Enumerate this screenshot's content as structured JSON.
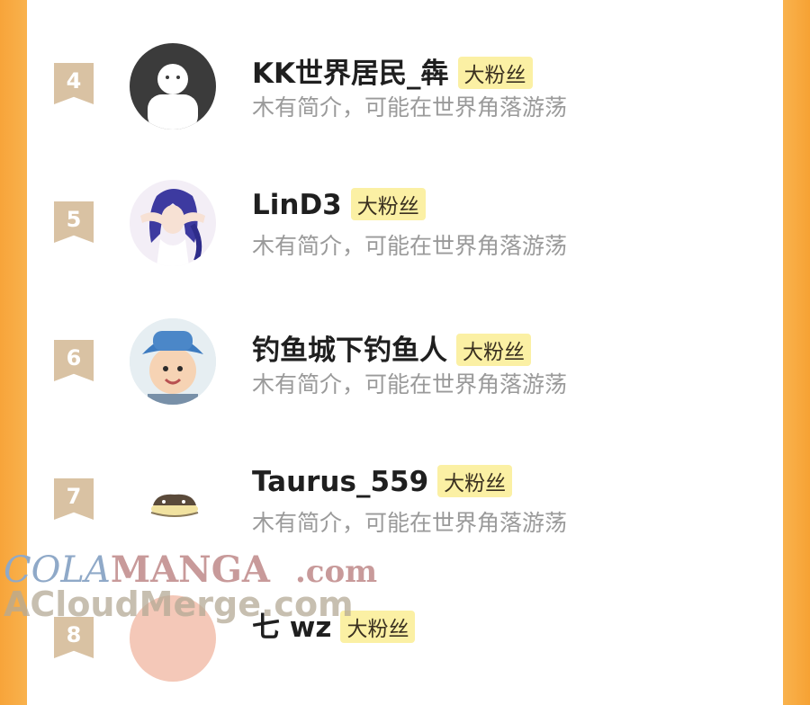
{
  "fans": [
    {
      "rank": "4",
      "name": "KK世界居民_犇",
      "badge": "大粉丝",
      "bio": "木有简介，可能在世界角落游荡",
      "avatar": "default-person-icon"
    },
    {
      "rank": "5",
      "name": "LinD3",
      "badge": "大粉丝",
      "bio": "木有简介，可能在世界角落游荡",
      "avatar": "anime-girl-avatar"
    },
    {
      "rank": "6",
      "name": "钓鱼城下钓鱼人",
      "badge": "大粉丝",
      "bio": "木有简介，可能在世界角落游荡",
      "avatar": "baby-with-hat-avatar"
    },
    {
      "rank": "7",
      "name": "Taurus_559",
      "badge": "大粉丝",
      "bio": "木有简介，可能在世界角落游荡",
      "avatar": "cat-sticker-avatar"
    },
    {
      "rank": "8",
      "name": "七    wz",
      "badge": "大粉丝",
      "bio": "",
      "avatar": "partial-avatar"
    }
  ],
  "watermark": {
    "line1_a": "COLA",
    "line1_b": "MANGA",
    "line1_c": ".com",
    "line2": "ACloudMerge.com"
  },
  "colors": {
    "side": "#f7a43a",
    "badge": "#fbf0a4",
    "rank": "#d9c2a3"
  }
}
